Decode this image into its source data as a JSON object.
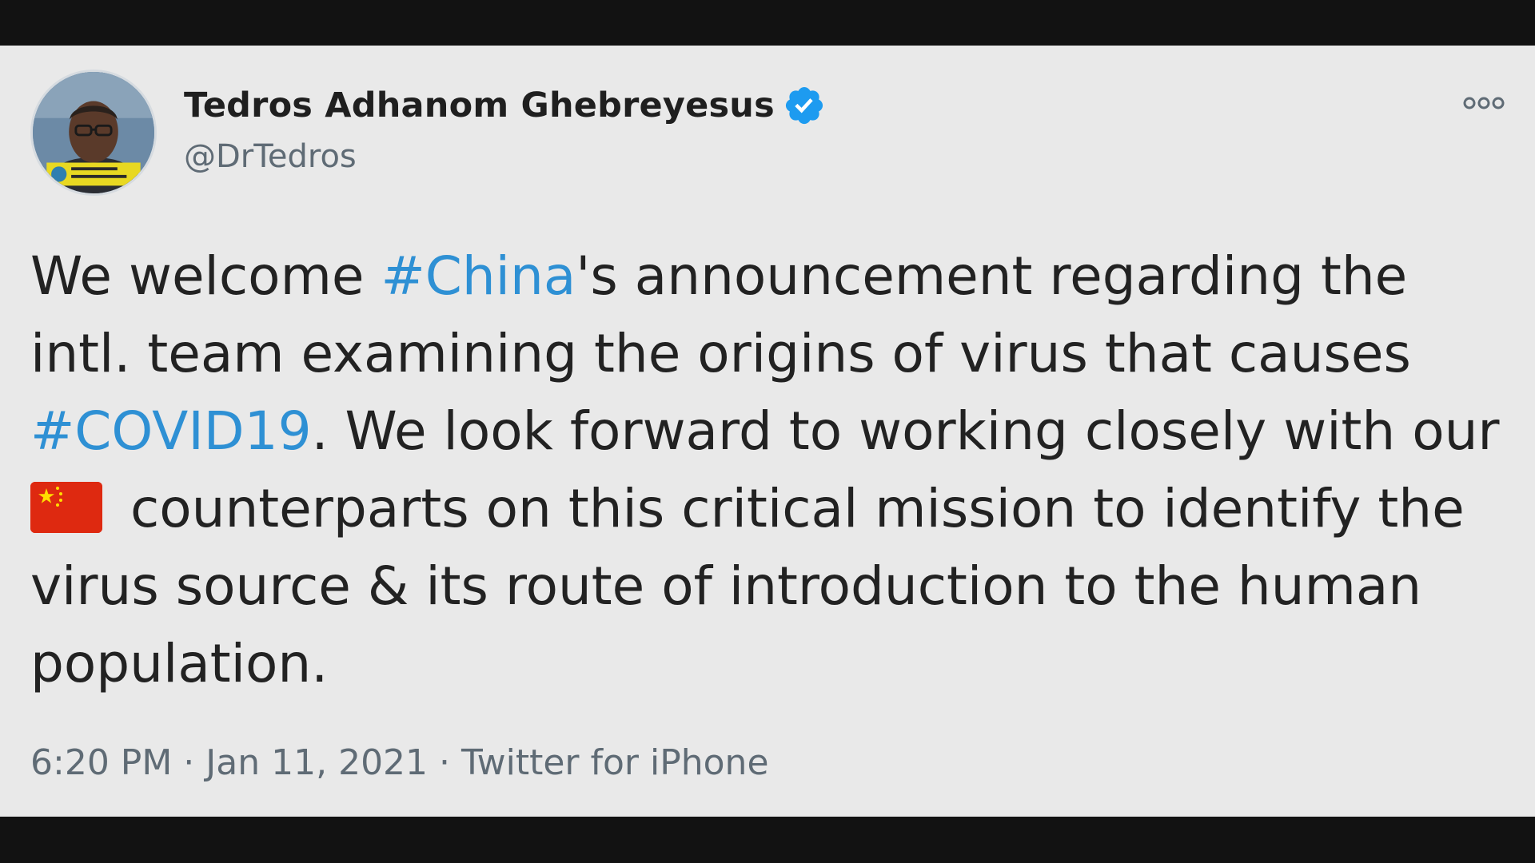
{
  "tweet": {
    "author": {
      "display_name": "Tedros Adhanom Ghebreyesus",
      "handle": "@DrTedros",
      "verified": true,
      "avatar_badge_text": "#HealthForAll"
    },
    "body": {
      "part1": "We welcome ",
      "hashtag_china": "#China",
      "part2": "'s announcement regarding the intl. team examining the origins of virus that causes ",
      "hashtag_covid": "#COVID19",
      "part3": ". We look forward to working closely with our",
      "flag": "china-flag-emoji",
      "part4": " counterparts on this critical mission to identify the virus source & its route of introduction to the human population."
    },
    "time": "6:20 PM",
    "separator": "·",
    "date": "Jan 11, 2021",
    "source": "Twitter for iPhone"
  },
  "icons": {
    "verified": "verified-badge-icon",
    "more": "more-options-icon"
  },
  "colors": {
    "background": "#e9e9e9",
    "letterbox": "#121212",
    "hashtag": "#2e90d4",
    "verified": "#1d9bf0",
    "text": "#222222",
    "muted": "#5f6b75"
  }
}
